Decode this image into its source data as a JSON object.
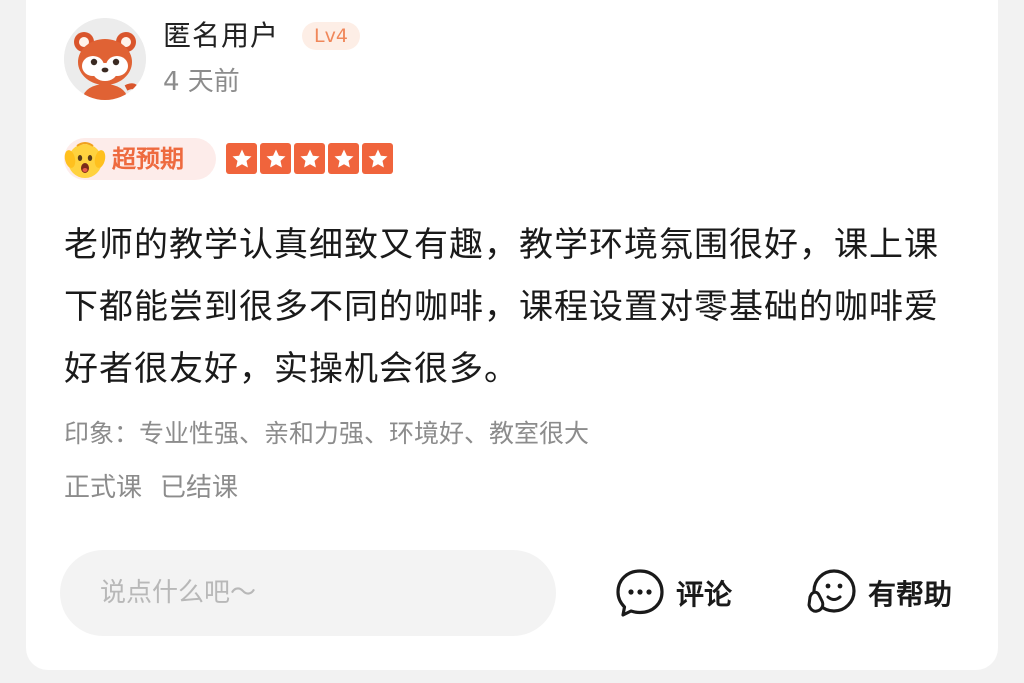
{
  "user": {
    "name": "匿名用户",
    "level": "Lv4",
    "time_ago": "4 天前",
    "avatar_icon": "red-panda-avatar"
  },
  "rating": {
    "tag_label": "超预期",
    "tag_icon": "surprised-emoji-icon",
    "stars": 5,
    "max_stars": 5,
    "star_color": "#f0643c"
  },
  "review": {
    "text": "老师的教学认真细致又有趣，教学环境氛围很好，课上课下都能尝到很多不同的咖啡，课程设置对零基础的咖啡爱好者很友好，实操机会很多。",
    "impression": "印象：专业性强、亲和力强、环境好、教室很大",
    "course_type": "正式课",
    "course_status": "已结课"
  },
  "actions": {
    "input_placeholder": "说点什么吧～",
    "comment_label": "评论",
    "comment_icon": "chat-bubble-icon",
    "helpful_label": "有帮助",
    "helpful_icon": "smiley-hand-icon"
  },
  "colors": {
    "accent": "#f0643c",
    "badge_text": "#f0875a",
    "badge_bg": "#fdeee6",
    "tag_bg": "#fdecea"
  }
}
